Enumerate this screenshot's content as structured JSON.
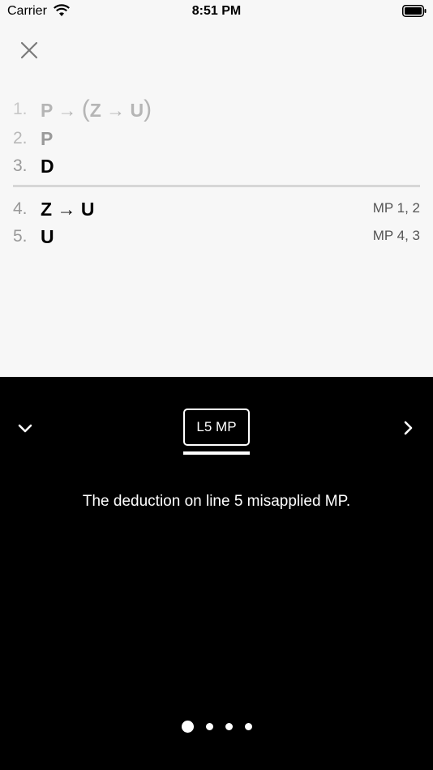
{
  "status_bar": {
    "carrier": "Carrier",
    "time": "8:51 PM"
  },
  "icons": {
    "close": "close-icon",
    "collapse": "chevron-down-icon",
    "next": "chevron-right-icon",
    "wifi": "wifi-icon",
    "battery": "battery-icon"
  },
  "proof": {
    "premises": [
      {
        "num": "1.",
        "formula_pre": "P → ",
        "formula_open": "(",
        "formula_inner": "Z → U",
        "formula_close": ")"
      },
      {
        "num": "2.",
        "formula": "P"
      },
      {
        "num": "3.",
        "formula": "D"
      }
    ],
    "steps": [
      {
        "num": "4.",
        "formula": "Z → U",
        "justification": "MP 1, 2"
      },
      {
        "num": "5.",
        "formula": "U",
        "justification": "MP 4, 3"
      }
    ]
  },
  "panel": {
    "tab_label": "L5 MP",
    "message": "The deduction on line 5 misapplied MP.",
    "page_count": 4,
    "current_page": 1
  },
  "colors": {
    "background": "#f7f7f7",
    "panel": "#000000",
    "divider": "#d6d6d6"
  }
}
